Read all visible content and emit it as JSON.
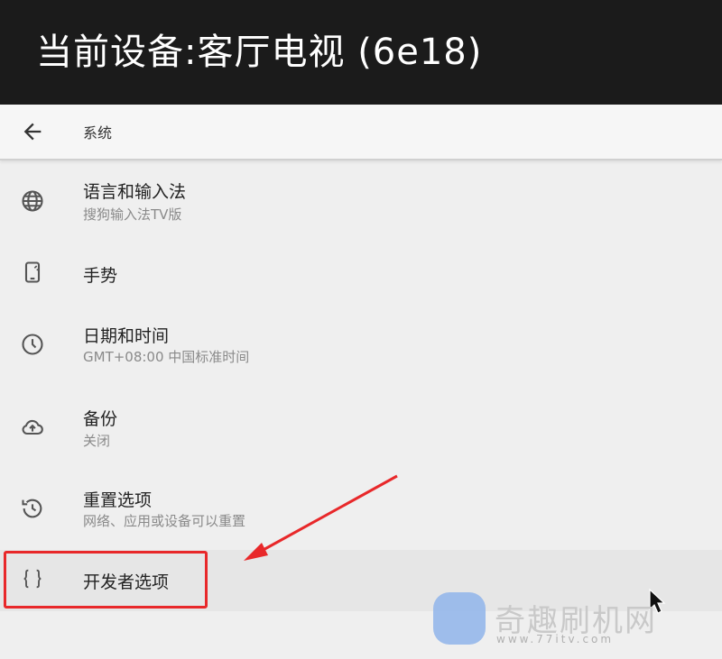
{
  "header": {
    "title": "当前设备:客厅电视 (6e18)"
  },
  "appbar": {
    "back_icon": "arrow-left-icon",
    "title": "系统"
  },
  "items": [
    {
      "icon": "globe-icon",
      "title": "语言和输入法",
      "subtitle": "搜狗输入法TV版"
    },
    {
      "icon": "phone-gesture-icon",
      "title": "手势",
      "subtitle": ""
    },
    {
      "icon": "clock-icon",
      "title": "日期和时间",
      "subtitle": "GMT+08:00 中国标准时间"
    },
    {
      "icon": "cloud-upload-icon",
      "title": "备份",
      "subtitle": "关闭"
    },
    {
      "icon": "history-icon",
      "title": "重置选项",
      "subtitle": "网络、应用或设备可以重置"
    },
    {
      "icon": "braces-icon",
      "title": "开发者选项",
      "subtitle": ""
    }
  ],
  "watermark": {
    "name": "奇趣刷机网",
    "url": "www.77itv.com"
  },
  "colors": {
    "header_bg": "#1b1b1b",
    "annotation_red": "#e8282a"
  }
}
